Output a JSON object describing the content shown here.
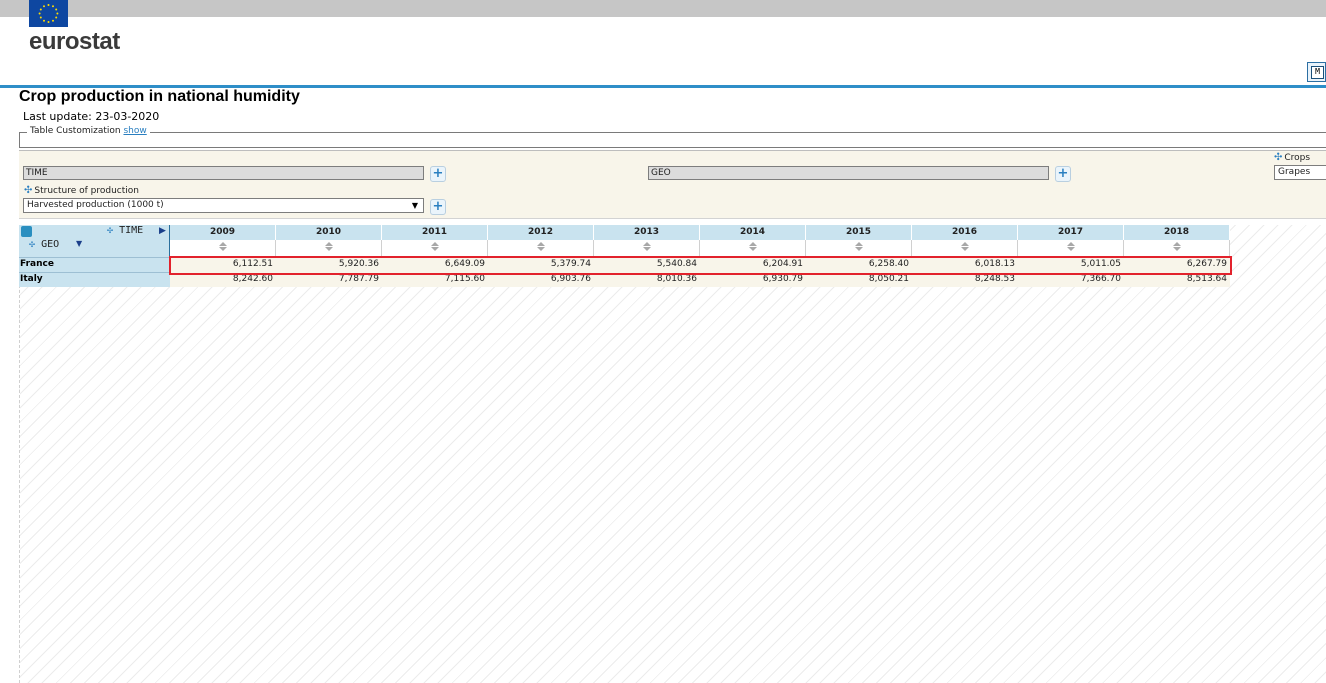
{
  "header": {
    "logo_text": "eurostat",
    "brand_color": "#0e47a1",
    "rule_color": "#2e8ec8"
  },
  "page": {
    "title": "Crop production in national humidity",
    "last_update": "Last update: 23-03-2020"
  },
  "customization": {
    "label": "Table Customization",
    "show_link": "show"
  },
  "filters": {
    "time_field": "TIME",
    "geo_field": "GEO",
    "structure_label": "Structure of production",
    "structure_value": "Harvested production (1000 t)",
    "crops_label": "Crops",
    "crops_value": "Grapes"
  },
  "table": {
    "time_axis_label": "TIME",
    "geo_axis_label": "GEO",
    "columns": [
      "2009",
      "2010",
      "2011",
      "2012",
      "2013",
      "2014",
      "2015",
      "2016",
      "2017",
      "2018"
    ],
    "rows": [
      {
        "label": "France",
        "values": [
          "6,112.51",
          "5,920.36",
          "6,649.09",
          "5,379.74",
          "5,540.84",
          "6,204.91",
          "6,258.40",
          "6,018.13",
          "5,011.05",
          "6,267.79"
        ]
      },
      {
        "label": "Italy",
        "values": [
          "8,242.60",
          "7,787.79",
          "7,115.60",
          "6,903.76",
          "8,010.36",
          "6,930.79",
          "8,050.21",
          "8,248.53",
          "7,366.70",
          "8,513.64"
        ]
      }
    ],
    "highlight_color": "#e2222c"
  }
}
